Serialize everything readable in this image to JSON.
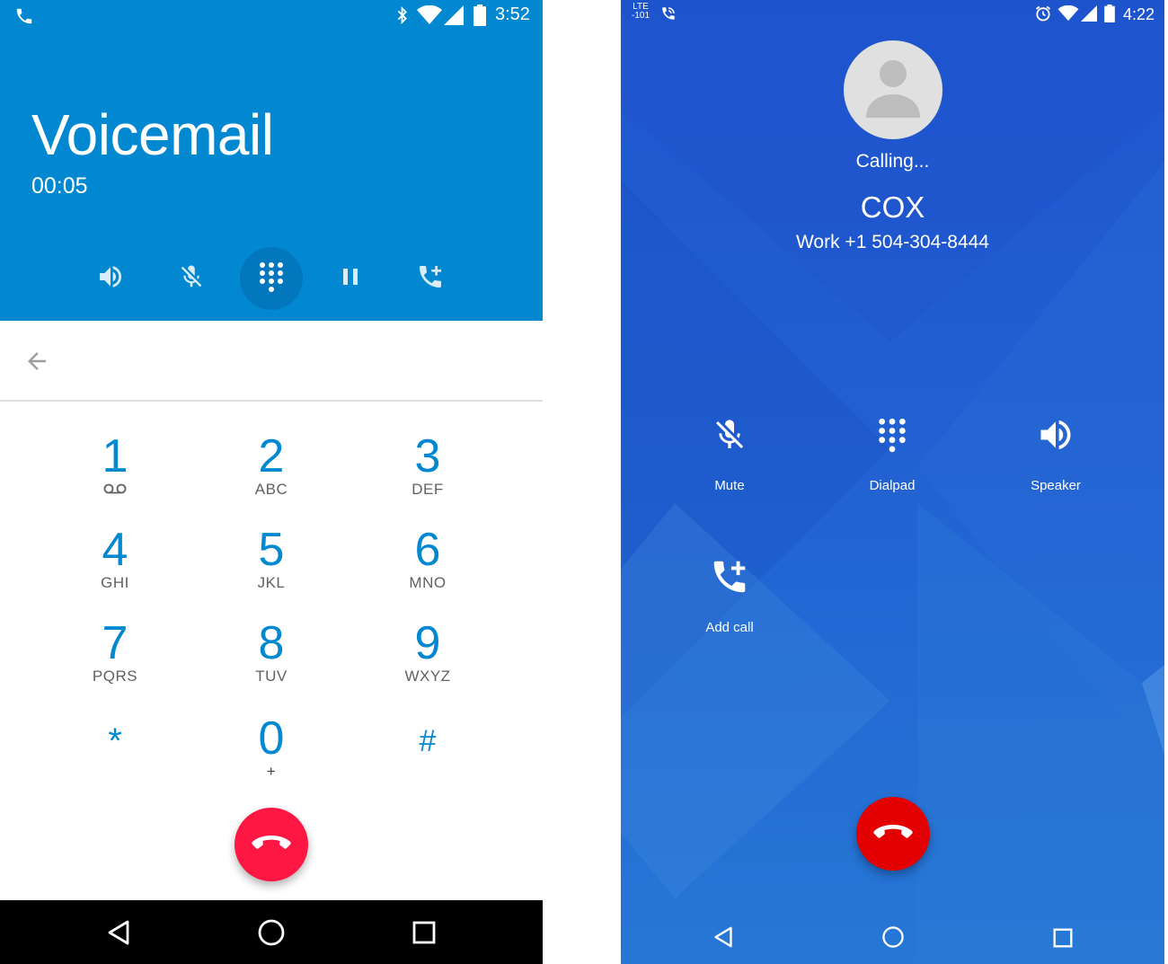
{
  "left_phone": {
    "status_bar": {
      "time": "3:52",
      "icons": [
        "phone-icon",
        "bluetooth-icon",
        "wifi-icon",
        "cell-signal-icon",
        "battery-icon"
      ]
    },
    "call_title": "Voicemail",
    "call_timer": "00:05",
    "call_controls": [
      {
        "name": "speaker",
        "icon": "speaker-icon"
      },
      {
        "name": "mute",
        "icon": "mute-icon"
      },
      {
        "name": "dialpad",
        "icon": "dialpad-icon",
        "active": true
      },
      {
        "name": "hold",
        "icon": "pause-icon"
      },
      {
        "name": "add-call",
        "icon": "add-call-icon"
      }
    ],
    "dialpad": [
      {
        "digit": "1",
        "letters": "voicemail-icon"
      },
      {
        "digit": "2",
        "letters": "ABC"
      },
      {
        "digit": "3",
        "letters": "DEF"
      },
      {
        "digit": "4",
        "letters": "GHI"
      },
      {
        "digit": "5",
        "letters": "JKL"
      },
      {
        "digit": "6",
        "letters": "MNO"
      },
      {
        "digit": "7",
        "letters": "PQRS"
      },
      {
        "digit": "8",
        "letters": "TUV"
      },
      {
        "digit": "9",
        "letters": "WXYZ"
      },
      {
        "digit": "*",
        "letters": ""
      },
      {
        "digit": "0",
        "letters": "+"
      },
      {
        "digit": "#",
        "letters": ""
      }
    ],
    "colors": {
      "header": "#0288d1",
      "end_call": "#ff1744",
      "digits": "#0288d1"
    }
  },
  "right_phone": {
    "status_bar": {
      "time": "4:22",
      "network_label_top": "LTE",
      "network_label_bottom": "-101",
      "icons": [
        "phone-icon",
        "alarm-icon",
        "wifi-icon",
        "cell-signal-icon",
        "battery-icon"
      ]
    },
    "status": "Calling...",
    "contact_name": "COX",
    "contact_number": "Work +1 504-304-8444",
    "buttons": [
      {
        "label": "Mute",
        "icon": "mute-icon"
      },
      {
        "label": "Dialpad",
        "icon": "dialpad-icon"
      },
      {
        "label": "Speaker",
        "icon": "speaker-icon"
      },
      {
        "label": "Add call",
        "icon": "add-call-icon"
      }
    ],
    "colors": {
      "background": "#2160d2",
      "end_call": "#e30000"
    }
  }
}
